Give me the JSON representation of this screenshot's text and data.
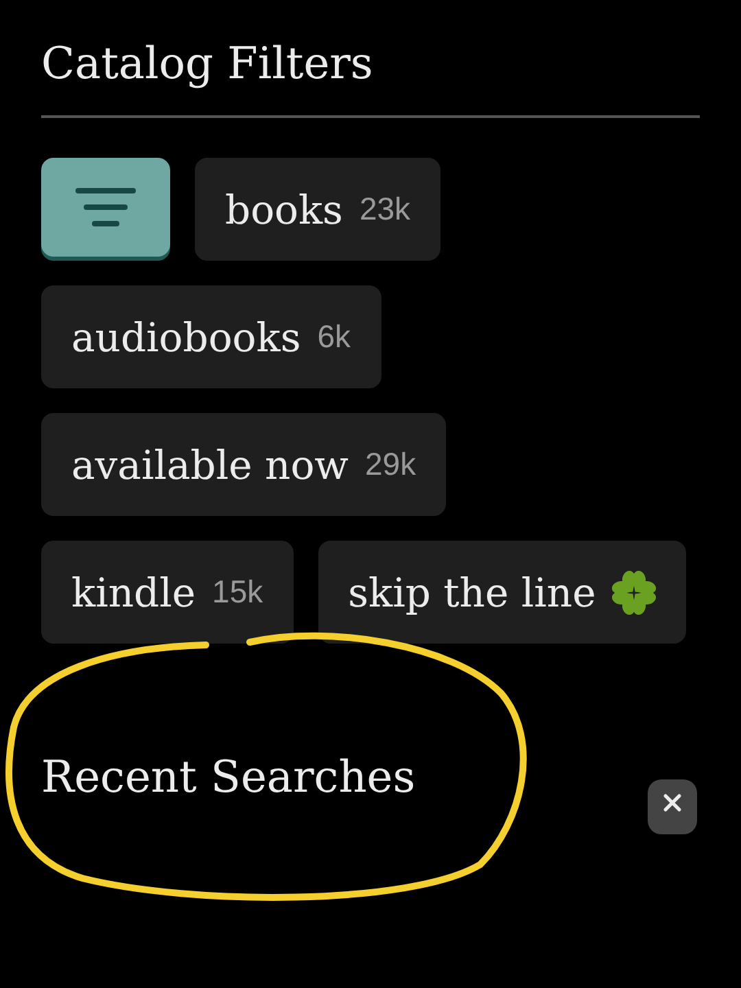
{
  "catalog_filters": {
    "title": "Catalog Filters",
    "chips": [
      {
        "kind": "count",
        "label": "books",
        "count": "23k"
      },
      {
        "kind": "count",
        "label": "audiobooks",
        "count": "6k"
      },
      {
        "kind": "count",
        "label": "available now",
        "count": "29k"
      },
      {
        "kind": "count",
        "label": "kindle",
        "count": "15k"
      },
      {
        "kind": "clover",
        "label": "skip the line"
      }
    ]
  },
  "recent_searches": {
    "title": "Recent Searches"
  }
}
